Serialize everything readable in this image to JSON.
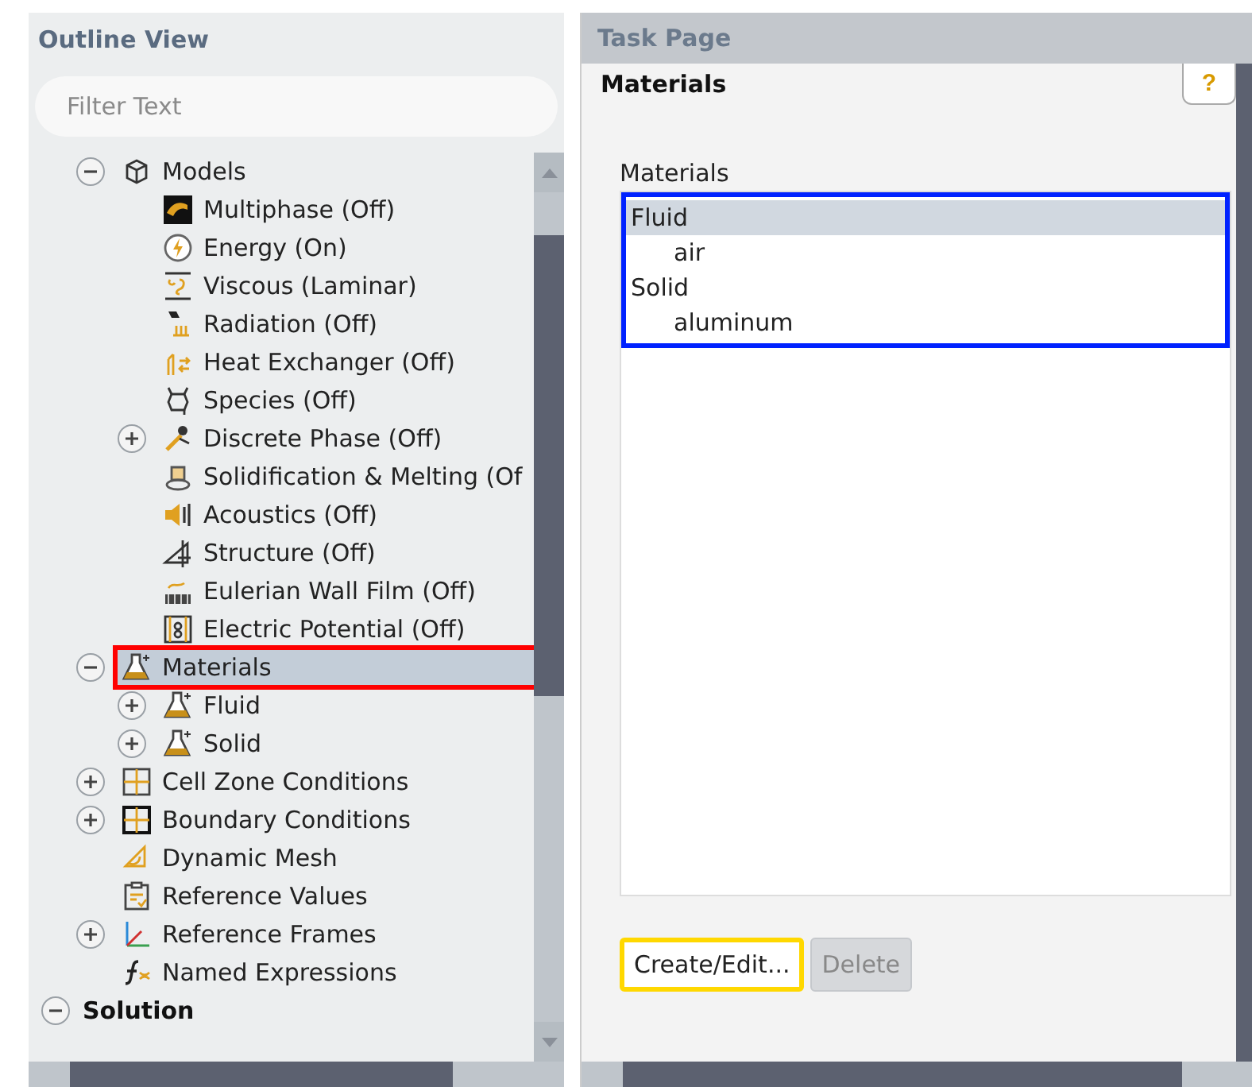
{
  "outline_view": {
    "title": "Outline View",
    "filter": {
      "placeholder": "Filter Text"
    },
    "tree": [
      {
        "label": "Models",
        "kind": "cube",
        "expanded": true,
        "selected": false,
        "highlighted": false,
        "children": [
          {
            "label": "Multiphase (Off)",
            "kind": "multiphase",
            "selected": false,
            "highlighted": false
          },
          {
            "label": "Energy (On)",
            "kind": "energy",
            "selected": false,
            "highlighted": false
          },
          {
            "label": "Viscous (Laminar)",
            "kind": "viscous",
            "selected": false,
            "highlighted": false
          },
          {
            "label": "Radiation (Off)",
            "kind": "radiation",
            "selected": false,
            "highlighted": false
          },
          {
            "label": "Heat Exchanger (Off)",
            "kind": "exchanger",
            "selected": false,
            "highlighted": false
          },
          {
            "label": "Species (Off)",
            "kind": "species",
            "selected": false,
            "highlighted": false
          },
          {
            "label": "Discrete Phase (Off)",
            "kind": "particle",
            "expanded": false,
            "selected": false,
            "highlighted": false
          },
          {
            "label": "Solidification & Melting (Of",
            "kind": "melting",
            "selected": false,
            "highlighted": false
          },
          {
            "label": "Acoustics (Off)",
            "kind": "acoustics",
            "selected": false,
            "highlighted": false
          },
          {
            "label": "Structure (Off)",
            "kind": "structure",
            "selected": false,
            "highlighted": false
          },
          {
            "label": "Eulerian Wall Film (Off)",
            "kind": "film",
            "selected": false,
            "highlighted": false
          },
          {
            "label": "Electric Potential (Off)",
            "kind": "electric",
            "selected": false,
            "highlighted": false
          }
        ]
      },
      {
        "label": "Materials",
        "kind": "flask",
        "expanded": true,
        "selected": true,
        "highlighted": true,
        "children": [
          {
            "label": "Fluid",
            "kind": "flask",
            "expanded": false,
            "selected": false,
            "highlighted": false
          },
          {
            "label": "Solid",
            "kind": "flask",
            "expanded": false,
            "selected": false,
            "highlighted": false
          }
        ]
      },
      {
        "label": "Cell Zone Conditions",
        "kind": "zones",
        "expanded": false,
        "selected": false,
        "highlighted": false
      },
      {
        "label": "Boundary Conditions",
        "kind": "boundary",
        "expanded": false,
        "selected": false,
        "highlighted": false
      },
      {
        "label": "Dynamic Mesh",
        "kind": "mesh",
        "selected": false,
        "highlighted": false
      },
      {
        "label": "Reference Values",
        "kind": "clipboard",
        "selected": false,
        "highlighted": false
      },
      {
        "label": "Reference Frames",
        "kind": "axes",
        "expanded": false,
        "selected": false,
        "highlighted": false
      },
      {
        "label": "Named Expressions",
        "kind": "function",
        "selected": false,
        "highlighted": false
      }
    ],
    "tree_footer": {
      "label": "Solution",
      "expanded": true
    }
  },
  "task_page": {
    "title": "Task Page",
    "heading": "Materials",
    "help_button": "?",
    "list": {
      "label": "Materials",
      "highlighted": true,
      "items": [
        {
          "label": "Fluid",
          "selected": true,
          "children": [
            {
              "label": "air",
              "selected": false
            }
          ]
        },
        {
          "label": "Solid",
          "selected": false,
          "children": [
            {
              "label": "aluminum",
              "selected": false
            }
          ]
        }
      ]
    },
    "buttons": [
      {
        "label": "Create/Edit...",
        "disabled": false,
        "highlighted": true
      },
      {
        "label": "Delete",
        "disabled": true,
        "highlighted": false
      }
    ]
  }
}
